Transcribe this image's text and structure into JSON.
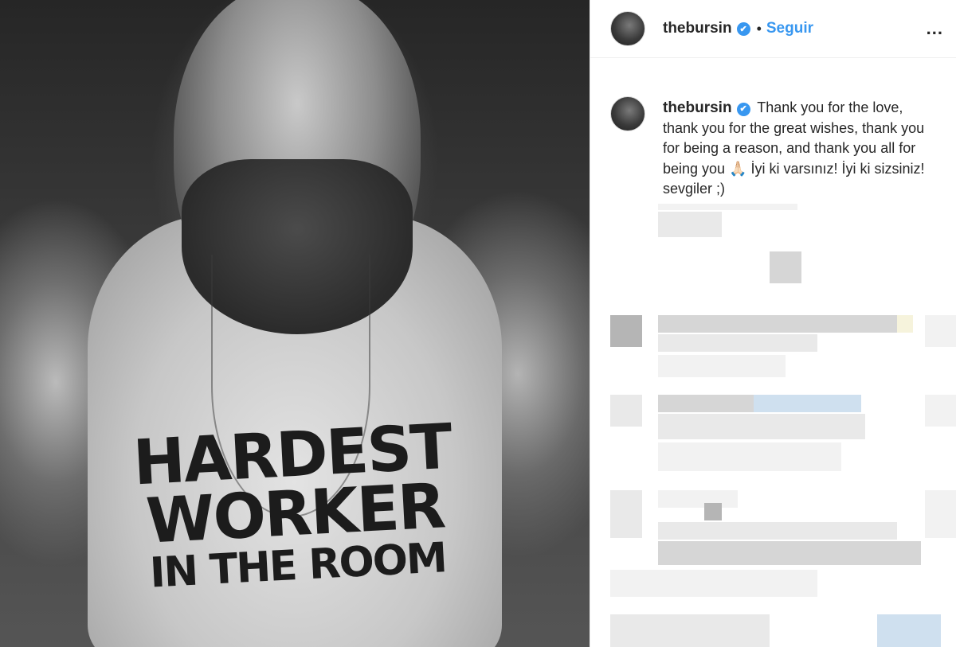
{
  "post": {
    "author": "thebursin",
    "follow_label": "Seguir",
    "more_label": "...",
    "separator": "•",
    "verified_symbol": "✔"
  },
  "photo": {
    "shirt_line1": "HARDEST",
    "shirt_line2": "WORKER",
    "shirt_line3": "IN THE ROOM"
  },
  "caption": {
    "author": "thebursin",
    "text": "Thank you for the love, thank you for the great wishes, thank you for being a reason, and thank you all for being you 🙏🏻 İyi ki varsınız! İyi ki sizsiniz! sevgiler ;)"
  },
  "colors": {
    "accent": "#3897f0",
    "text": "#262626",
    "border": "#efefef"
  }
}
